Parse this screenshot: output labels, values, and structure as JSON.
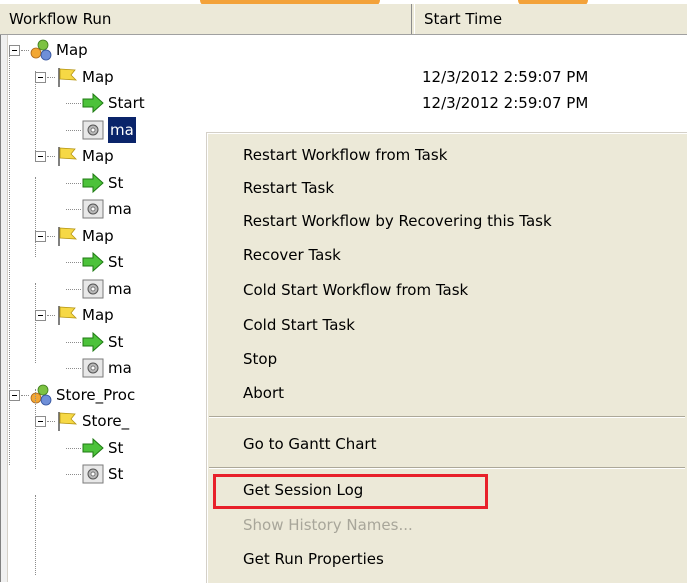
{
  "header": {
    "col_workflow": "Workflow Run",
    "col_start": "Start Time"
  },
  "tree": [
    {
      "label": "Map",
      "icon": "workflow-icon",
      "time": ""
    },
    {
      "label": "Map",
      "icon": "flag-icon",
      "time": "12/3/2012 2:59:07 PM"
    },
    {
      "label": "Start",
      "icon": "green-arrow-icon",
      "time": "12/3/2012 2:59:07 PM"
    },
    {
      "label": "ma",
      "icon": "session-gear-icon",
      "time": "",
      "selected": true
    },
    {
      "label": "Map",
      "icon": "flag-icon"
    },
    {
      "label": "St",
      "icon": "green-arrow-icon"
    },
    {
      "label": "ma",
      "icon": "session-gear-icon"
    },
    {
      "label": "Map",
      "icon": "flag-icon"
    },
    {
      "label": "St",
      "icon": "green-arrow-icon"
    },
    {
      "label": "ma",
      "icon": "session-gear-icon"
    },
    {
      "label": "Map",
      "icon": "flag-icon"
    },
    {
      "label": "St",
      "icon": "green-arrow-icon"
    },
    {
      "label": "ma",
      "icon": "session-gear-icon"
    },
    {
      "label": "Store_Proc",
      "icon": "workflow-icon"
    },
    {
      "label": "Store_",
      "icon": "flag-icon"
    },
    {
      "label": "St",
      "icon": "green-arrow-icon"
    },
    {
      "label": "St",
      "icon": "session-gear-icon"
    }
  ],
  "menu": {
    "items": [
      "Restart Workflow from Task",
      "Restart Task",
      "Restart Workflow by Recovering this Task",
      "Recover Task",
      "Cold Start Workflow from Task",
      "Cold Start Task",
      "Stop",
      "Abort",
      "Go to Gantt Chart",
      "Get Session Log",
      "Show History Names...",
      "Get Run Properties"
    ],
    "disabled": [
      "Show History Names..."
    ],
    "highlighted": "Get Session Log",
    "highlight_color": "#e8202a"
  },
  "colors": {
    "accent_orange": "#f3a23a",
    "selection": "#0a246a",
    "menu_bg": "#ece9d8"
  }
}
